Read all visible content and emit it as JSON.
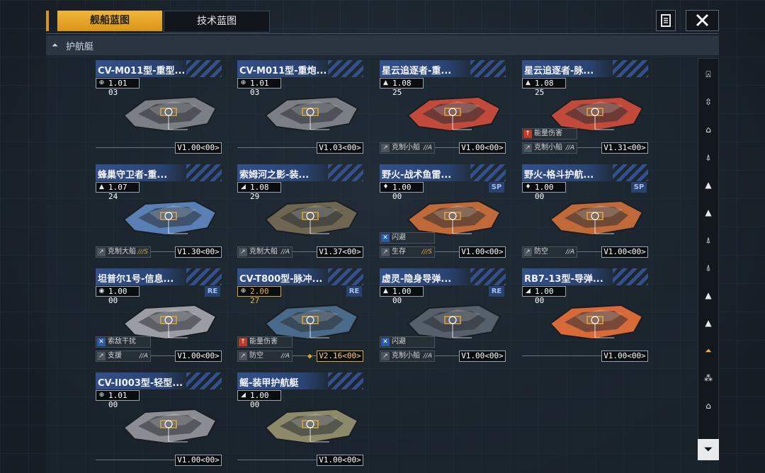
{
  "tabs": [
    {
      "label": "舰船蓝图",
      "active": true
    },
    {
      "label": "技术蓝图",
      "active": false
    }
  ],
  "header": {
    "list_icon": "list-icon",
    "close_icon": "close-icon"
  },
  "section": {
    "title": "护航艇",
    "icon": "collapse-triangle-icon"
  },
  "cards": [
    {
      "title": "CV-M011型-重型...",
      "type_icon": "globe-icon",
      "version": "1.01 03",
      "level": "V1.00<00>",
      "badge": "",
      "ship_color": "#7a7f86",
      "traits": []
    },
    {
      "title": "CV-M011型-重炮...",
      "type_icon": "globe-icon",
      "version": "1.01 03",
      "level": "V1.03<00>",
      "badge": "",
      "ship_color": "#7a7f86",
      "traits": []
    },
    {
      "title": "星云追逐者-重...",
      "type_icon": "rocket-icon",
      "version": "1.08 25",
      "level": "V1.00<00>",
      "badge": "",
      "ship_color": "#c24a3a",
      "traits": [
        {
          "label": "克制小船",
          "rank": "//A",
          "icon": "grey"
        }
      ]
    },
    {
      "title": "星云追逐者-脉...",
      "type_icon": "rocket-icon",
      "version": "1.08 25",
      "level": "V1.31<00>",
      "badge": "",
      "ship_color": "#c24a3a",
      "traits": [
        {
          "label": "能量伤害",
          "rank": "",
          "icon": "red"
        },
        {
          "label": "克制小船",
          "rank": "//A",
          "icon": "grey"
        }
      ]
    },
    {
      "title": "蜂巢守卫者-重...",
      "type_icon": "rocket-icon",
      "version": "1.07 24",
      "level": "V1.30<00>",
      "badge": "",
      "ship_color": "#5a7fb5",
      "traits": [
        {
          "label": "克制大船",
          "rank": "///S",
          "icon": "grey"
        }
      ]
    },
    {
      "title": "索姆河之影-装...",
      "type_icon": "wing-icon",
      "version": "1.08 29",
      "level": "V1.37<00>",
      "badge": "",
      "ship_color": "#6e6650",
      "traits": [
        {
          "label": "克制大船",
          "rank": "//A",
          "icon": "grey"
        }
      ]
    },
    {
      "title": "野火-战术鱼雷...",
      "type_icon": "flame-icon",
      "version": "1.00 00",
      "level": "V1.00<00>",
      "badge": "SP",
      "ship_color": "#c06a3a",
      "traits": [
        {
          "label": "闪避",
          "rank": "",
          "icon": "blue"
        },
        {
          "label": "生存",
          "rank": "///S",
          "icon": "grey"
        }
      ]
    },
    {
      "title": "野火-格斗护航...",
      "type_icon": "flame-icon",
      "version": "1.00 00",
      "level": "V1.00<00>",
      "badge": "SP",
      "ship_color": "#c06a3a",
      "traits": [
        {
          "label": "防空",
          "rank": "//A",
          "icon": "grey"
        }
      ]
    },
    {
      "title": "坦普尔1号-信息...",
      "type_icon": "tank-icon",
      "version": "1.00 00",
      "level": "V1.00<00>",
      "badge": "RE",
      "ship_color": "#9a9ea4",
      "traits": [
        {
          "label": "索敌干扰",
          "rank": "",
          "icon": "blue"
        },
        {
          "label": "支援",
          "rank": "//A",
          "icon": "grey"
        }
      ]
    },
    {
      "title": "CV-T800型-脉冲...",
      "type_icon": "globe-icon",
      "version": "2.00 27",
      "version_gold": true,
      "level": "V2.16<00>",
      "level_gold": true,
      "badge": "RE",
      "ship_color": "#4a6a8a",
      "traits": [
        {
          "label": "能量伤害",
          "rank": "",
          "icon": "red"
        },
        {
          "label": "防空",
          "rank": "//A",
          "icon": "grey"
        }
      ]
    },
    {
      "title": "虚灵-隐身导弹...",
      "type_icon": "rocket-icon",
      "version": "1.00 00",
      "level": "V1.00<00>",
      "badge": "RE",
      "ship_color": "#56606a",
      "traits": [
        {
          "label": "闪避",
          "rank": "",
          "icon": "blue"
        },
        {
          "label": "克制小船",
          "rank": "//A",
          "icon": "grey"
        }
      ]
    },
    {
      "title": "RB7-13型-导弹...",
      "type_icon": "wing-icon",
      "version": "1.00 00",
      "level": "V1.00<00>",
      "badge": "",
      "ship_color": "#d86a3a",
      "traits": []
    },
    {
      "title": "CV-II003型-轻型...",
      "type_icon": "globe-icon",
      "version": "1.01 00",
      "level": "V1.00<00>",
      "badge": "",
      "ship_color": "#8a8e94",
      "traits": []
    },
    {
      "title": "鳐-装甲护航艇",
      "type_icon": "wing-icon",
      "version": "1.00 00",
      "level": "V1.00<00>",
      "badge": "",
      "ship_color": "#8c8a6a",
      "traits": []
    }
  ],
  "sidebar": {
    "items": [
      "ship-class-1-icon",
      "ship-class-2-icon",
      "ship-class-3-icon",
      "ship-class-4-icon",
      "ship-class-5-icon",
      "ship-class-6-icon",
      "ship-class-7-icon",
      "ship-class-8-icon",
      "ship-class-9-icon",
      "ship-class-10-icon",
      "ship-class-11-icon",
      "ship-class-12-icon",
      "ship-class-13-icon"
    ],
    "active_index": 10
  },
  "filter": {
    "icon": "filter-icon"
  },
  "colors": {
    "accent": "#f2b53a",
    "title_bar": "#33508a",
    "trait_red": "#c03a2a",
    "trait_blue": "#2a5aa8"
  }
}
